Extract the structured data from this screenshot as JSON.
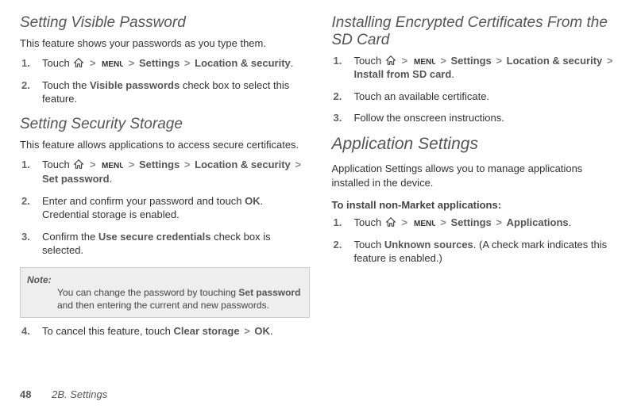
{
  "glyphs": {
    "gt": ">"
  },
  "left": {
    "section1": {
      "heading": "Setting Visible Password",
      "blurb": "This feature shows your passwords as you type them.",
      "steps": [
        {
          "num": "1.",
          "parts": [
            "Touch ",
            {
              "icon": "home"
            },
            " ",
            {
              "gt": true
            },
            " ",
            {
              "icon": "menu"
            },
            " ",
            {
              "gt": true
            },
            " ",
            {
              "bold": "Settings"
            },
            " ",
            {
              "gt": true
            },
            " ",
            {
              "bold": "Location & security"
            },
            "."
          ]
        },
        {
          "num": "2.",
          "parts": [
            "Touch the ",
            {
              "bold": "Visible passwords"
            },
            " check box to select this feature."
          ]
        }
      ]
    },
    "section2": {
      "heading": "Setting Security Storage",
      "blurb": "This feature allows applications to access secure certificates.",
      "steps_a": [
        {
          "num": "1.",
          "parts": [
            "Touch ",
            {
              "icon": "home"
            },
            " ",
            {
              "gt": true
            },
            " ",
            {
              "icon": "menu"
            },
            " ",
            {
              "gt": true
            },
            " ",
            {
              "bold": "Settings"
            },
            " ",
            {
              "gt": true
            },
            " ",
            {
              "bold": "Location & security"
            },
            " ",
            {
              "gt": true
            },
            " ",
            {
              "bold": "Set password"
            },
            "."
          ]
        },
        {
          "num": "2.",
          "parts": [
            "Enter and confirm your password and touch ",
            {
              "bold": "OK"
            },
            ". Credential storage is enabled."
          ]
        },
        {
          "num": "3.",
          "parts": [
            "Confirm the ",
            {
              "bold": "Use secure credentials"
            },
            " check box is selected."
          ]
        }
      ],
      "note_label": "Note:",
      "note_body_parts": [
        "You can change the password by touching ",
        {
          "bold": "Set password"
        },
        " and then entering the current and new passwords."
      ],
      "steps_b": [
        {
          "num": "4.",
          "parts": [
            "To cancel this feature, touch ",
            {
              "bold": "Clear storage"
            },
            " ",
            {
              "gt": true
            },
            " ",
            {
              "bold": "OK"
            },
            "."
          ]
        }
      ]
    }
  },
  "right": {
    "section1": {
      "heading": "Installing Encrypted Certificates From the SD Card",
      "steps": [
        {
          "num": "1.",
          "parts": [
            "Touch ",
            {
              "icon": "home"
            },
            " ",
            {
              "gt": true
            },
            " ",
            {
              "icon": "menu"
            },
            " ",
            {
              "gt": true
            },
            " ",
            {
              "bold": "Settings"
            },
            " ",
            {
              "gt": true
            },
            " ",
            {
              "bold": "Location & security"
            },
            " ",
            {
              "gt": true
            },
            " ",
            {
              "bold": "Install from SD card"
            },
            "."
          ]
        },
        {
          "num": "2.",
          "parts": [
            "Touch an available certificate."
          ]
        },
        {
          "num": "3.",
          "parts": [
            "Follow the onscreen instructions."
          ]
        }
      ]
    },
    "section2": {
      "heading": "Application Settings",
      "blurb": "Application Settings allows you to manage applications installed in the device.",
      "subhead": "To install non-Market applications:",
      "steps": [
        {
          "num": "1.",
          "parts": [
            "Touch ",
            {
              "icon": "home"
            },
            " ",
            {
              "gt": true
            },
            " ",
            {
              "icon": "menu"
            },
            " ",
            {
              "gt": true
            },
            " ",
            {
              "bold": "Settings"
            },
            " ",
            {
              "gt": true
            },
            " ",
            {
              "bold": "Applications"
            },
            "."
          ]
        },
        {
          "num": "2.",
          "parts": [
            "Touch ",
            {
              "bold": "Unknown sources"
            },
            ". (A check mark indicates this feature is enabled.)"
          ]
        }
      ]
    }
  },
  "footer": {
    "page": "48",
    "chapter": "2B. Settings"
  }
}
